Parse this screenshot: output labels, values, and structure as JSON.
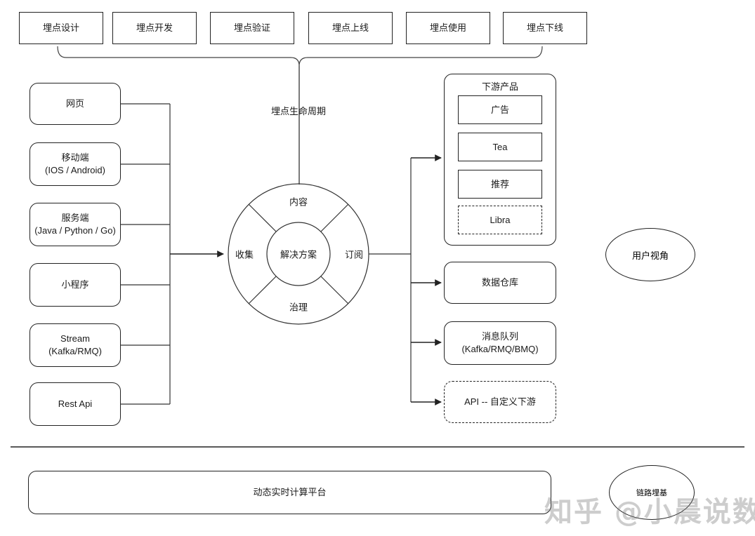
{
  "diagram": {
    "lifecycle": {
      "center_label": "埋点生命周期",
      "stages": [
        {
          "label": "埋点设计"
        },
        {
          "label": "埋点开发"
        },
        {
          "label": "埋点验证"
        },
        {
          "label": "埋点上线"
        },
        {
          "label": "埋点使用"
        },
        {
          "label": "埋点下线"
        }
      ]
    },
    "sources": {
      "items": [
        {
          "label": "网页"
        },
        {
          "label": "移动端\n(IOS / Android)"
        },
        {
          "label": "服务端\n(Java / Python / Go)"
        },
        {
          "label": "小程序"
        },
        {
          "label": "Stream\n(Kafka/RMQ)"
        },
        {
          "label": "Rest Api"
        }
      ]
    },
    "wheel": {
      "center": "解决方案",
      "quadrants": {
        "top": "内容",
        "right": "订阅",
        "bottom": "治理",
        "left": "收集"
      }
    },
    "downstream": {
      "group_title": "下游产品",
      "products": [
        {
          "label": "广告",
          "style": "solid"
        },
        {
          "label": "Tea",
          "style": "solid"
        },
        {
          "label": "推荐",
          "style": "solid"
        },
        {
          "label": "Libra",
          "style": "dashed"
        }
      ],
      "targets": [
        {
          "label": "数据仓库",
          "style": "solid"
        },
        {
          "label": "消息队列\n(Kafka/RMQ/BMQ)",
          "style": "solid"
        },
        {
          "label": "API -- 自定义下游",
          "style": "dashed"
        }
      ]
    },
    "user_view": {
      "label": "用户视角"
    },
    "platform": {
      "label": "动态实时计算平台",
      "side_note": "链路埋基"
    },
    "watermark": {
      "text": "知乎 @小晨说数据"
    },
    "colors": {
      "stroke": "#222222",
      "background": "#ffffff",
      "text": "#1a1a1a",
      "watermark": "#828282"
    }
  }
}
